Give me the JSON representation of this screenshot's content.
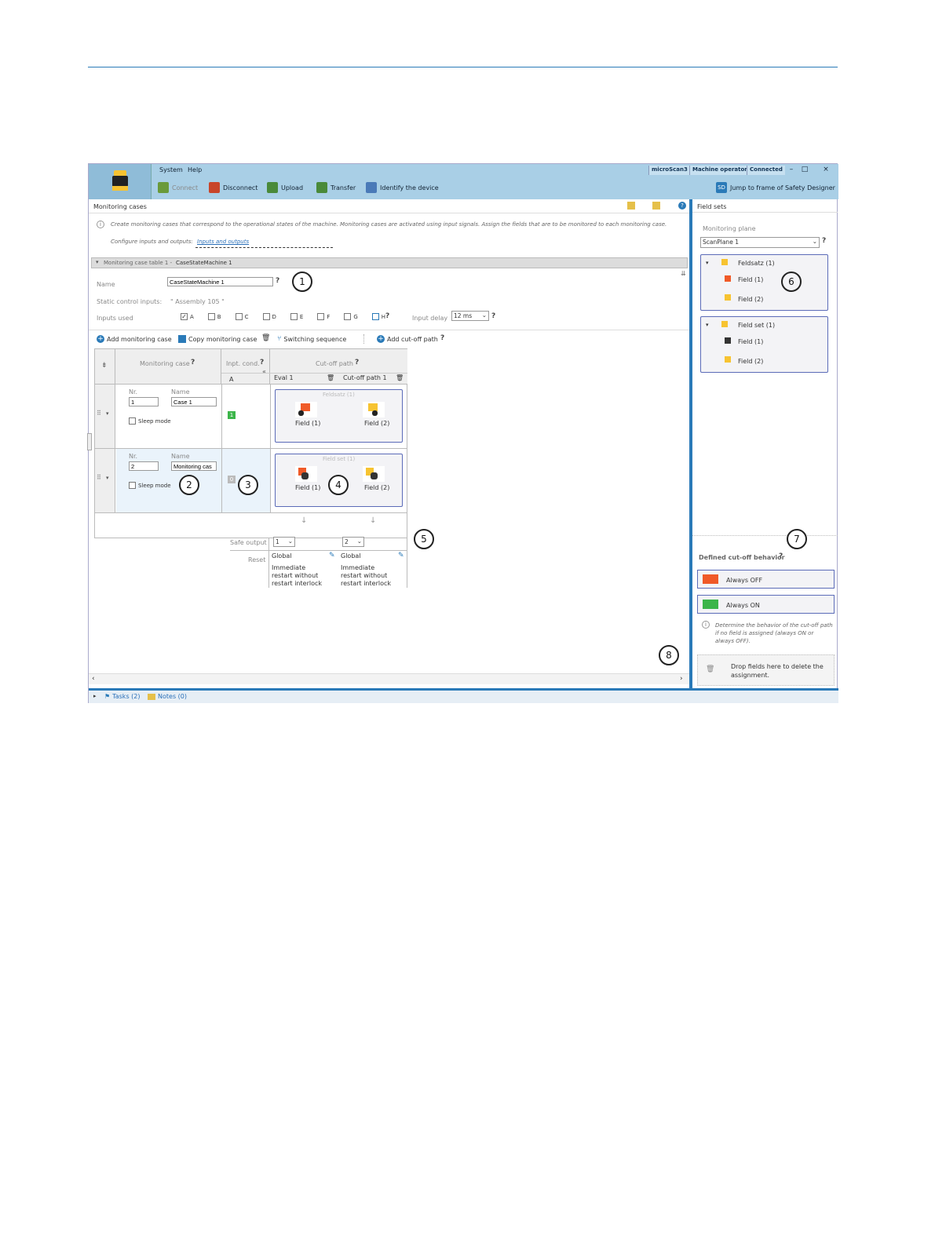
{
  "menu": {
    "system": "System",
    "help": "Help"
  },
  "toolbar": {
    "connect": "Connect",
    "disconnect": "Disconnect",
    "upload": "Upload",
    "transfer": "Transfer",
    "identify": "Identify the device",
    "jump_badge": "SD",
    "jump": "Jump to frame of Safety Designer"
  },
  "status": {
    "device": "microScan3",
    "user": "Machine operator",
    "connection": "Connected"
  },
  "panel": {
    "title": "Monitoring cases",
    "info": "Create monitoring cases that correspond to the operational states of the machine. Monitoring cases are activated using input signals. Assign the fields that are to be monitored to each monitoring case.",
    "configure_label": "Configure inputs and outputs:",
    "configure_link": "Inputs and outputs",
    "table_header_prefix": "Monitoring case table 1 - ",
    "table_header_name": "CaseStateMachine 1",
    "name_label": "Name",
    "name_value": "CaseStateMachine 1",
    "static_label": "Static control inputs:",
    "static_value": "\" Assembly 105 \"",
    "inputs_label": "Inputs used",
    "inputs": [
      "A",
      "B",
      "C",
      "D",
      "E",
      "F",
      "G",
      "H"
    ],
    "input_delay_label": "Input delay",
    "input_delay_value": "12 ms"
  },
  "actions": {
    "add_case": "Add monitoring case",
    "copy_case": "Copy monitoring case",
    "switching": "Switching sequence",
    "add_path": "Add cut-off path"
  },
  "table": {
    "col_case": "Monitoring case",
    "col_cond": "Inpt. cond.",
    "col_cond_sub": "A",
    "col_path": "Cut-off path",
    "eval": "Eval 1",
    "path1": "Cut-off path 1",
    "nr_label": "Nr.",
    "name_label": "Name",
    "sleep_label": "Sleep mode",
    "rows": [
      {
        "nr": "1",
        "name": "Case 1",
        "cond": "1",
        "set": "Feldsatz (1)",
        "f1": "Field (1)",
        "f2": "Field (2)"
      },
      {
        "nr": "2",
        "name": "Monitoring cas",
        "cond": "0",
        "set": "Field set (1)",
        "f1": "Field (1)",
        "f2": "Field (2)"
      }
    ],
    "safe_output_label": "Safe output",
    "safe_output_1": "1",
    "safe_output_2": "2",
    "reset_label": "Reset",
    "reset_scope": "Global",
    "reset_text": "Immediate restart without restart interlock"
  },
  "callouts": [
    "1",
    "2",
    "3",
    "4",
    "5",
    "6",
    "7",
    "8"
  ],
  "sidebar": {
    "title": "Field sets",
    "plane_label": "Monitoring plane",
    "plane_value": "ScanPlane 1",
    "sets": [
      {
        "name": "Feldsatz (1)",
        "f1": "Field (1)",
        "f2": "Field (2)"
      },
      {
        "name": "Field set (1)",
        "f1": "Field (1)",
        "f2": "Field (2)"
      }
    ],
    "cutoff_title": "Defined cut-off behavior",
    "always_off": "Always OFF",
    "always_on": "Always ON",
    "hint": "Determine the behavior of the cut-off path if no field is assigned (always ON or always OFF).",
    "drop": "Drop fields here to delete the assignment."
  },
  "bottom": {
    "tasks": "Tasks (2)",
    "notes": "Notes (0)"
  },
  "colors": {
    "accent": "#2a7ab8",
    "off": "#f05a28",
    "on": "#3cb54a",
    "field_orange": "#f05a28",
    "field_yellow": "#f7c331"
  }
}
